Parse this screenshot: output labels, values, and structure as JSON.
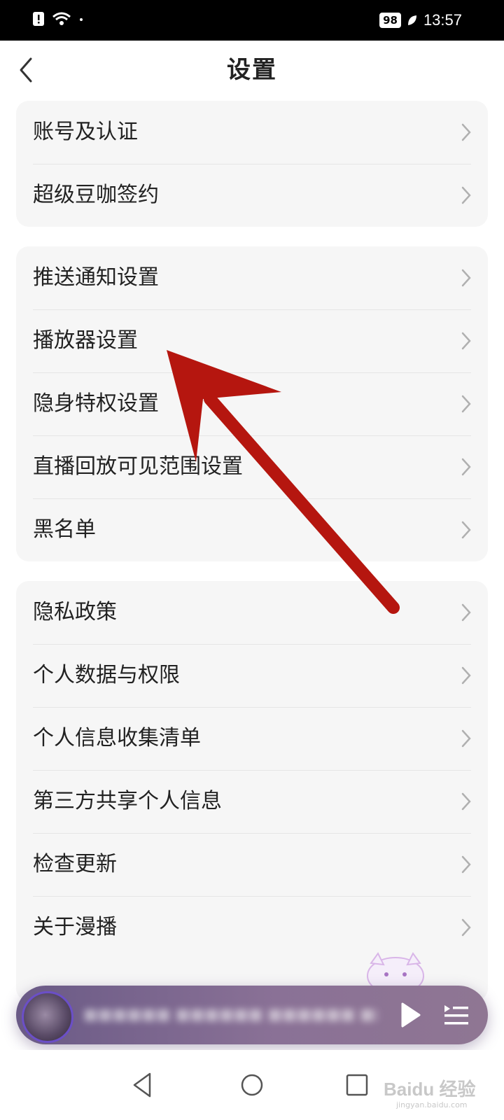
{
  "status_bar": {
    "battery": "98",
    "time": "13:57"
  },
  "header": {
    "title": "设置"
  },
  "groups": [
    {
      "items": [
        {
          "label": "账号及认证"
        },
        {
          "label": "超级豆咖签约"
        }
      ]
    },
    {
      "items": [
        {
          "label": "推送通知设置"
        },
        {
          "label": "播放器设置"
        },
        {
          "label": "隐身特权设置"
        },
        {
          "label": "直播回放可见范围设置"
        },
        {
          "label": "黑名单"
        }
      ]
    },
    {
      "items": [
        {
          "label": "隐私政策"
        },
        {
          "label": "个人数据与权限"
        },
        {
          "label": "个人信息收集清单"
        },
        {
          "label": "第三方共享个人信息"
        },
        {
          "label": "检查更新"
        },
        {
          "label": "关于漫播"
        }
      ]
    }
  ],
  "player": {
    "title": "■■■■■■ ■■■■■■ ■■■■■■ ■■■"
  },
  "watermark": {
    "brand": "Baidu 经验",
    "sub": "jingyan.baidu.com"
  },
  "colors": {
    "annotation_arrow": "#b5160f",
    "card_background": "#f6f6f6",
    "player_gradient_start": "#6a5a86"
  }
}
